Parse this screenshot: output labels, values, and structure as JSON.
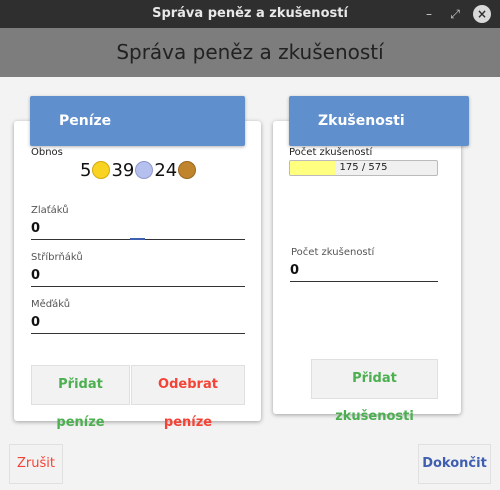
{
  "window": {
    "title": "Správa peněz a zkušeností"
  },
  "header": {
    "title": "Správa peněz a zkušeností"
  },
  "money": {
    "title": "Peníze",
    "balance_label": "Obnos",
    "balance": {
      "gold": "5",
      "silver": "39",
      "copper": "24"
    },
    "coin_colors": {
      "gold": "#f8d322",
      "silver": "#b6c0ee",
      "copper": "#c0842c"
    },
    "gold_label": "Zlaťáků",
    "gold_value": "0",
    "silver_label": "Stříbrňáků",
    "silver_value": "0",
    "copper_label": "Měďáků",
    "copper_value": "0",
    "add_button": "Přidat peníze",
    "remove_button": "Odebrat peníze"
  },
  "xp": {
    "title": "Zkušenosti",
    "progress_label": "Počet zkušeností",
    "progress_current": 175,
    "progress_max": 575,
    "progress_text": "175 / 575",
    "input_label": "Počet zkušeností",
    "input_value": "0",
    "add_button": "Přidat zkušenosti"
  },
  "footer": {
    "cancel_button": "Zrušit",
    "finish_button": "Dokončit"
  },
  "colors": {
    "accent": "#5f8fcd",
    "add": "#4caf50",
    "remove": "#f44336",
    "finish": "#3f5fb0"
  }
}
